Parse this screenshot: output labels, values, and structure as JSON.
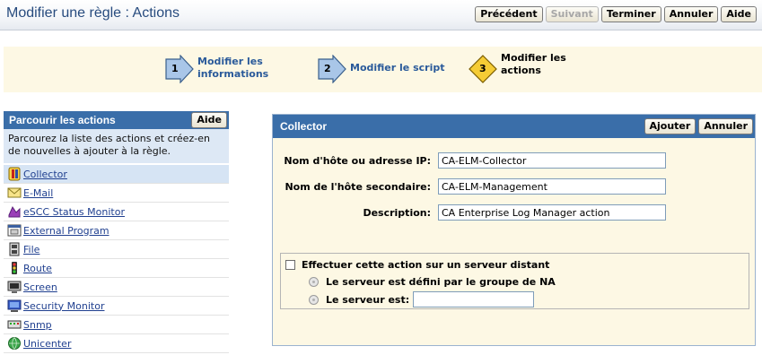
{
  "header": {
    "title": "Modifier une règle : Actions",
    "buttons": {
      "previous": "Précédent",
      "next": "Suivant",
      "finish": "Terminer",
      "cancel": "Annuler",
      "help": "Aide"
    }
  },
  "wizard": {
    "steps": [
      {
        "number": "1",
        "label_line1": "Modifier les",
        "label_line2": "informations",
        "state": "done"
      },
      {
        "number": "2",
        "label_line1": "Modifier le script",
        "label_line2": "",
        "state": "done"
      },
      {
        "number": "3",
        "label_line1": "Modifier les",
        "label_line2": "actions",
        "state": "current"
      }
    ]
  },
  "left_panel": {
    "title": "Parcourir les actions",
    "help_label": "Aide",
    "description": "Parcourez la liste des actions et créez-en de nouvelles à ajouter à la règle.",
    "actions": [
      {
        "label": "Collector",
        "icon": "collector-icon"
      },
      {
        "label": "E-Mail",
        "icon": "envelope-icon"
      },
      {
        "label": "eSCC Status Monitor",
        "icon": "escc-monitor-icon"
      },
      {
        "label": "External Program",
        "icon": "program-window-icon"
      },
      {
        "label": "File",
        "icon": "file-cabinet-icon"
      },
      {
        "label": "Route",
        "icon": "traffic-light-icon"
      },
      {
        "label": "Screen",
        "icon": "screen-icon"
      },
      {
        "label": "Security Monitor",
        "icon": "security-monitor-icon"
      },
      {
        "label": "Snmp",
        "icon": "snmp-icon"
      },
      {
        "label": "Unicenter",
        "icon": "globe-icon"
      }
    ],
    "selected_index": 0
  },
  "right_panel": {
    "title": "Collector",
    "add_label": "Ajouter",
    "cancel_label": "Annuler",
    "fields": {
      "host_label": "Nom d'hôte ou adresse IP:",
      "host_value": "CA-ELM-Collector",
      "secondary_label": "Nom de l'hôte secondaire:",
      "secondary_value": "CA-ELM-Management",
      "description_label": "Description:",
      "description_value": "CA Enterprise Log Manager action"
    },
    "remote": {
      "checkbox_label": "Effectuer cette action sur un serveur distant",
      "checked": false,
      "radio_na_label": "Le serveur est défini par le groupe de NA",
      "radio_server_label": "Le serveur est:",
      "server_value": ""
    }
  },
  "colors": {
    "accent": "#3a6ea9",
    "title": "#274b7e",
    "wizard_bg": "#fdf8e4",
    "step_done": "#a9c6e8",
    "step_current": "#f5cc35",
    "link": "#1f3f8f"
  }
}
